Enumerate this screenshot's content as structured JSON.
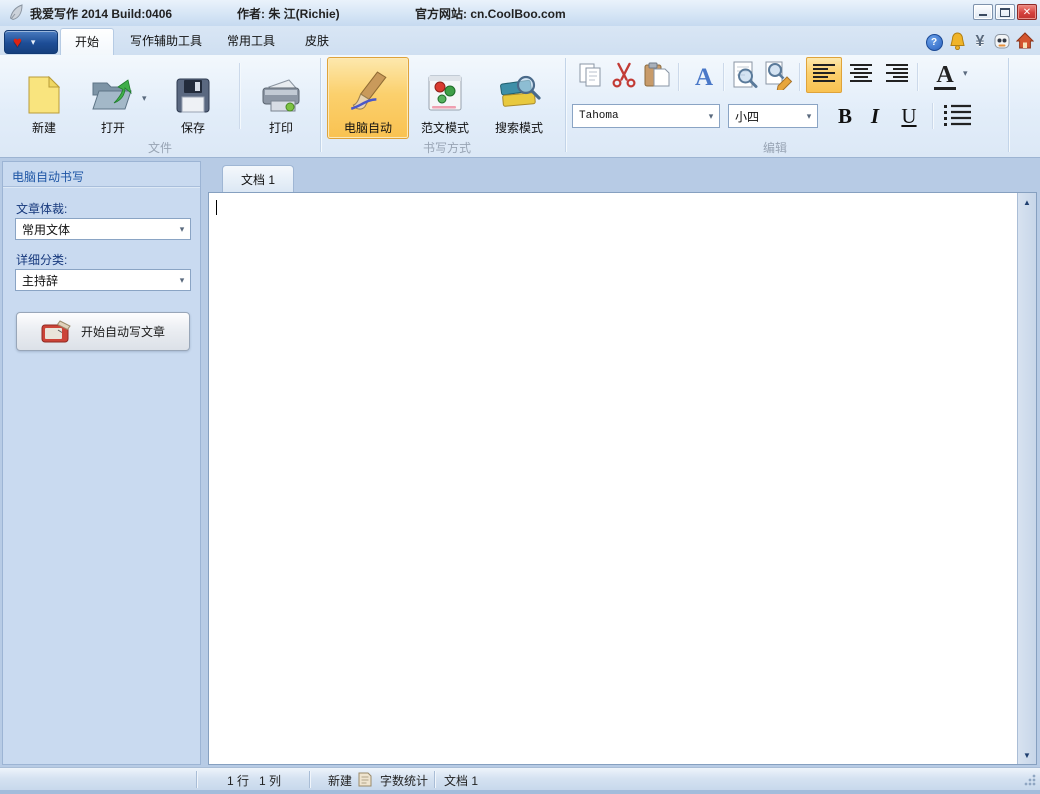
{
  "titlebar": {
    "title": "我爱写作 2014 Build:0406",
    "author": "作者: 朱 江(Richie)",
    "website": "官方网站: cn.CoolBoo.com"
  },
  "tabbar": {
    "tabs": {
      "start": "开始",
      "assist": "写作辅助工具",
      "common": "常用工具",
      "skin": "皮肤"
    }
  },
  "ribbon": {
    "file_group": {
      "label": "文件",
      "new": "新建",
      "open": "打开",
      "save": "保存",
      "print": "打印"
    },
    "mode_group": {
      "label": "书写方式",
      "auto": "电脑自动",
      "sample": "范文模式",
      "search": "搜索模式"
    },
    "edit_group": {
      "label": "编辑",
      "font_name": "Tahoma",
      "font_size": "小四",
      "bold": "B",
      "italic": "I",
      "underline": "U",
      "font_color_letter": "A"
    }
  },
  "sidebar": {
    "header": "电脑自动书写",
    "genre_label": "文章体裁:",
    "genre_value": "常用文体",
    "category_label": "详细分类:",
    "category_value": "主持辞",
    "start_button": "开始自动写文章"
  },
  "editor": {
    "doc_tab": "文档 1"
  },
  "statusbar": {
    "line_col": "1 行   1 列",
    "new_label": "新建",
    "word_count": "字数统计",
    "doc_label": "文档 1"
  },
  "glyphs": {
    "heart": "♥",
    "dropdown": "▾",
    "up_arrow": "▲",
    "down_arrow": "▼",
    "close": "✕",
    "help": "?",
    "yen": "¥"
  },
  "colors": {
    "accent_orange": "#fbd06d",
    "selected_border": "#dfa33a",
    "titlebar_blue": "#d9e7f7",
    "sidebar_panel": "#c9daf0",
    "header_text_blue": "#1d55a5",
    "close_red": "#d5413d",
    "heart_red": "#dd2211",
    "brand_blue": "#1d4d96"
  }
}
